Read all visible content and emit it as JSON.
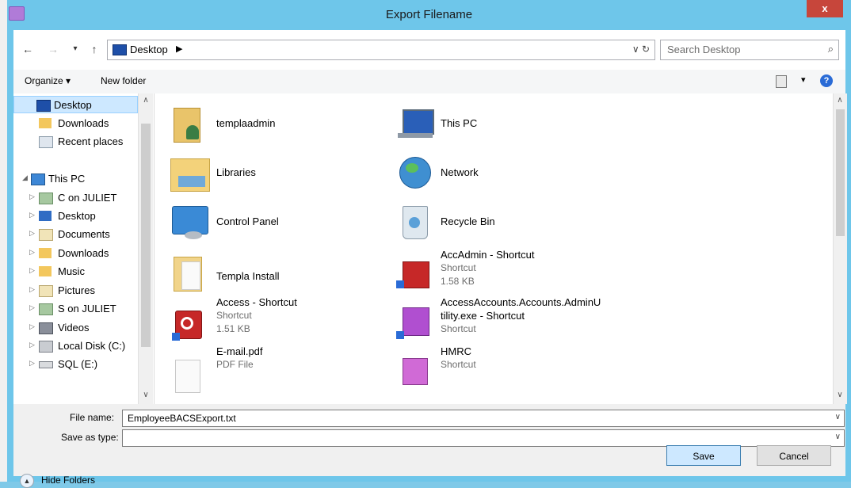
{
  "window": {
    "title": "Export Filename",
    "close_glyph": "x"
  },
  "address_bar": {
    "location": "Desktop",
    "separator": "▶",
    "controls": "∨  ↻",
    "search_placeholder": "Search Desktop",
    "search_icon": "⌕"
  },
  "toolbar": {
    "organize": "Organize ▾",
    "new_folder": "New folder",
    "view_caret": "▾",
    "help": "?"
  },
  "nav_pane": {
    "favorites": [
      {
        "label": "Desktop",
        "icon": "desktop-icon",
        "selected": true
      },
      {
        "label": "Downloads",
        "icon": "downloads-icon"
      },
      {
        "label": "Recent places",
        "icon": "recent-places-icon"
      }
    ],
    "this_pc": {
      "label": "This PC",
      "expander": "◢"
    },
    "pc_items": [
      {
        "label": "C on JULIET",
        "icon": "network-drive-icon"
      },
      {
        "label": "Desktop",
        "icon": "desktop-folder-icon"
      },
      {
        "label": "Documents",
        "icon": "documents-icon"
      },
      {
        "label": "Downloads",
        "icon": "downloads-icon"
      },
      {
        "label": "Music",
        "icon": "music-icon"
      },
      {
        "label": "Pictures",
        "icon": "pictures-icon"
      },
      {
        "label": "S on JULIET",
        "icon": "network-drive-icon"
      },
      {
        "label": "Videos",
        "icon": "videos-icon"
      },
      {
        "label": "Local Disk (C:)",
        "icon": "local-disk-icon"
      },
      {
        "label": "SQL (E:)",
        "icon": "drive-icon"
      }
    ],
    "expander": "▷"
  },
  "items": [
    {
      "name": "templaadmin",
      "icon": "user-folder-icon"
    },
    {
      "name": "This PC",
      "icon": "computer-icon"
    },
    {
      "name": "Libraries",
      "icon": "libraries-icon"
    },
    {
      "name": "Network",
      "icon": "network-icon"
    },
    {
      "name": "Control Panel",
      "icon": "control-panel-icon"
    },
    {
      "name": "Recycle Bin",
      "icon": "recycle-bin-icon"
    },
    {
      "name": "Templa Install",
      "icon": "folder-icon"
    },
    {
      "name": "AccAdmin - Shortcut",
      "type": "Shortcut",
      "size": "1.58 KB",
      "icon": "shortcut-tools-icon"
    },
    {
      "name": "Access - Shortcut",
      "type": "Shortcut",
      "size": "1.51 KB",
      "icon": "access-icon"
    },
    {
      "name": "AccessAccounts.Accounts.AdminU",
      "name2": "tility.exe - Shortcut",
      "type": "Shortcut",
      "icon": "admin-utility-icon"
    },
    {
      "name": "E-mail.pdf",
      "type": "PDF File",
      "icon": "pdf-file-icon"
    },
    {
      "name": "HMRC",
      "type": "Shortcut",
      "icon": "hmrc-icon"
    }
  ],
  "form": {
    "file_name_label": "File name:",
    "file_name_value": "EmployeeBACSExport.txt",
    "save_as_type_label": "Save as type:",
    "save_as_type_value": "",
    "dropdown_caret": "∨"
  },
  "footer": {
    "hide_folders": "Hide Folders",
    "hide_glyph": "▲",
    "save": "Save",
    "cancel": "Cancel"
  },
  "colors": {
    "title_bar": "#6ec6ea",
    "close_button": "#c7463b",
    "selection": "#cde8ff",
    "save_button": "#cde8ff"
  }
}
